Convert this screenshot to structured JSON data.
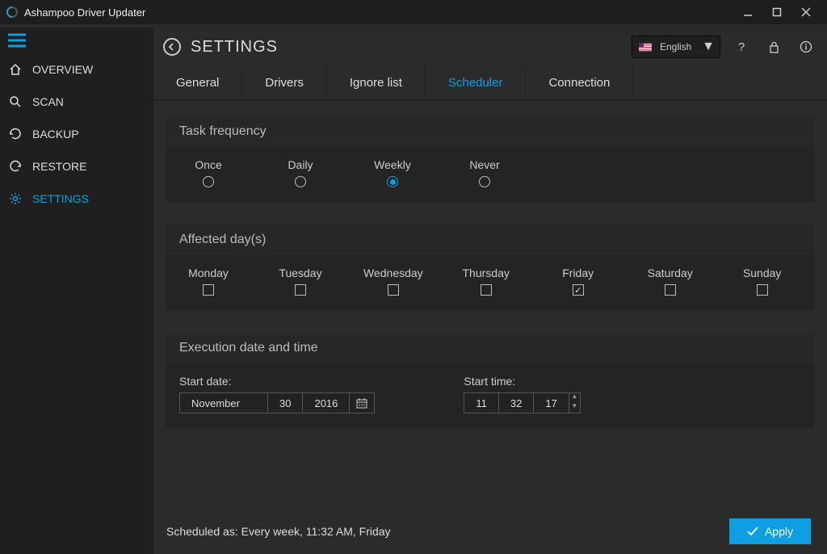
{
  "app": {
    "title": "Ashampoo Driver Updater"
  },
  "sidebar": {
    "items": [
      {
        "label": "OVERVIEW",
        "icon": "home"
      },
      {
        "label": "SCAN",
        "icon": "search"
      },
      {
        "label": "BACKUP",
        "icon": "backup"
      },
      {
        "label": "RESTORE",
        "icon": "restore"
      },
      {
        "label": "SETTINGS",
        "icon": "gear",
        "active": true
      }
    ]
  },
  "header": {
    "title": "SETTINGS",
    "language": "English"
  },
  "tabs": [
    "General",
    "Drivers",
    "Ignore list",
    "Scheduler",
    "Connection"
  ],
  "active_tab": "Scheduler",
  "sections": {
    "frequency": {
      "title": "Task frequency",
      "options": [
        "Once",
        "Daily",
        "Weekly",
        "Never"
      ],
      "selected": "Weekly"
    },
    "days": {
      "title": "Affected day(s)",
      "options": [
        "Monday",
        "Tuesday",
        "Wednesday",
        "Thursday",
        "Friday",
        "Saturday",
        "Sunday"
      ],
      "checked": [
        "Friday"
      ]
    },
    "execution": {
      "title": "Execution date and time",
      "start_date_label": "Start date:",
      "start_time_label": "Start time:",
      "date": {
        "month": "November",
        "day": "30",
        "year": "2016"
      },
      "time": {
        "hour": "11",
        "minute": "32",
        "second": "17"
      }
    }
  },
  "footer": {
    "status": "Scheduled as: Every week, 11:32 AM, Friday",
    "apply": "Apply"
  }
}
